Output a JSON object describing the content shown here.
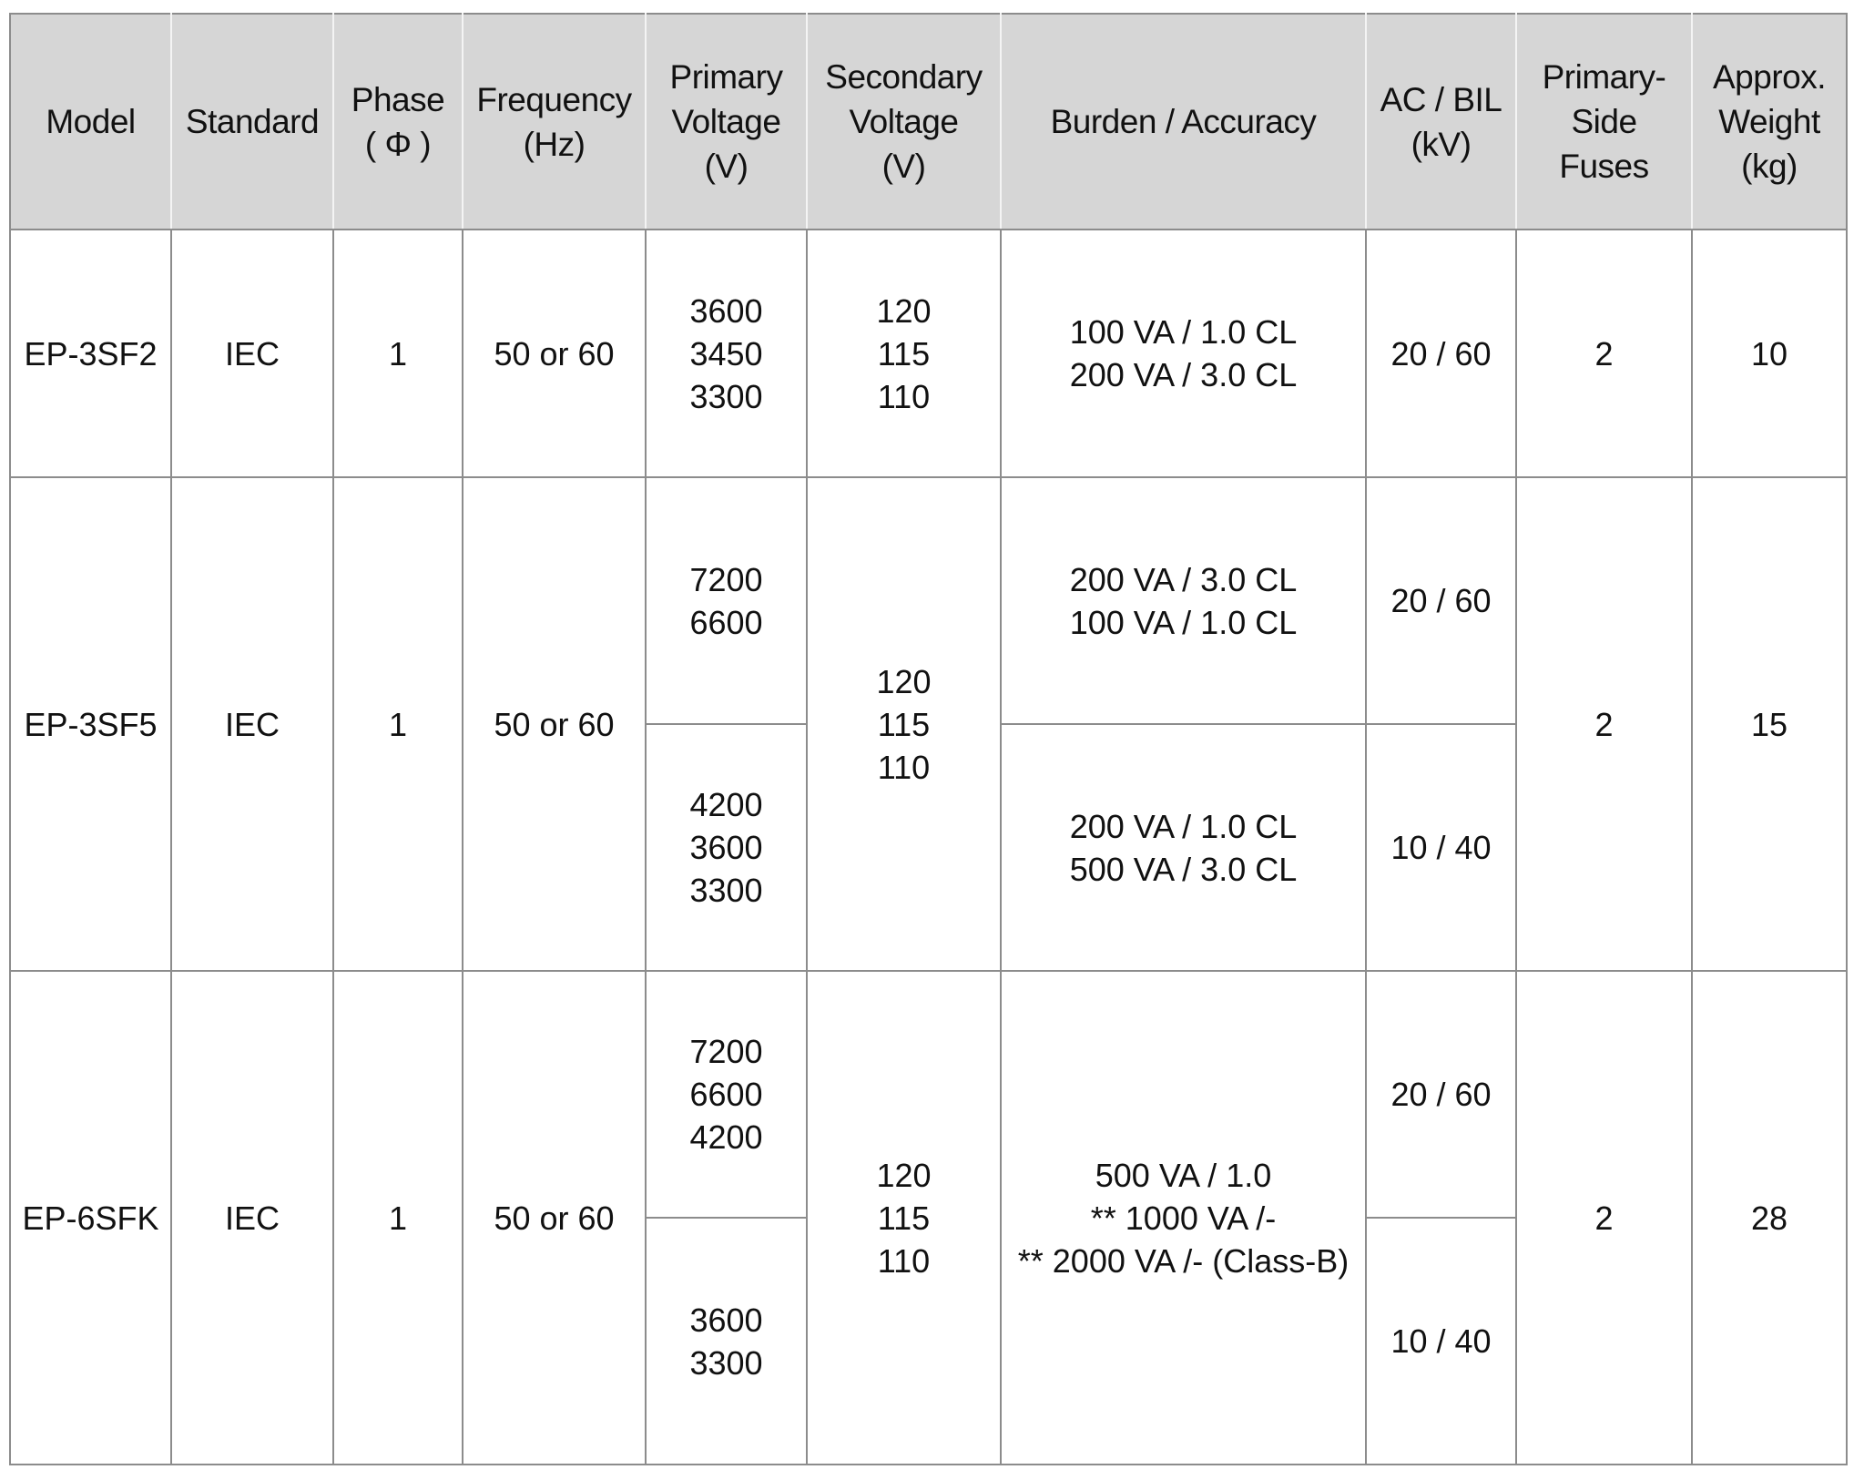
{
  "table": {
    "headers": [
      [
        "Model"
      ],
      [
        "Standard"
      ],
      [
        "Phase",
        "( Φ )"
      ],
      [
        "Frequency",
        "(Hz)"
      ],
      [
        "Primary",
        "Voltage",
        "(V)"
      ],
      [
        "Secondary",
        "Voltage",
        "(V)"
      ],
      [
        "Burden / Accuracy"
      ],
      [
        "AC / BIL",
        "(kV)"
      ],
      [
        "Primary-",
        "Side",
        "Fuses"
      ],
      [
        "Approx.",
        "Weight",
        "(kg)"
      ]
    ],
    "rows": [
      {
        "model": "EP-3SF2",
        "standard": "IEC",
        "phase": "1",
        "frequency": "50 or 60",
        "primary_voltage": [
          [
            "3600",
            "3450",
            "3300"
          ]
        ],
        "secondary_voltage": [
          "120",
          "115",
          "110"
        ],
        "burden_accuracy": [
          [
            "100 VA / 1.0 CL",
            "200 VA / 3.0 CL"
          ]
        ],
        "ac_bil": [
          "20 / 60"
        ],
        "primary_side_fuses": "2",
        "weight": "10"
      },
      {
        "model": "EP-3SF5",
        "standard": "IEC",
        "phase": "1",
        "frequency": "50 or 60",
        "primary_voltage": [
          [
            "7200",
            "6600"
          ],
          [
            "4200",
            "3600",
            "3300"
          ]
        ],
        "secondary_voltage": [
          "120",
          "115",
          "110"
        ],
        "burden_accuracy": [
          [
            "200 VA / 3.0 CL",
            "100 VA / 1.0 CL"
          ],
          [
            "200 VA / 1.0 CL",
            "500 VA / 3.0 CL"
          ]
        ],
        "ac_bil": [
          "20 / 60",
          "10 / 40"
        ],
        "primary_side_fuses": "2",
        "weight": "15"
      },
      {
        "model": "EP-6SFK",
        "standard": "IEC",
        "phase": "1",
        "frequency": "50 or 60",
        "primary_voltage": [
          [
            "7200",
            "6600",
            "4200"
          ],
          [
            "3600",
            "3300"
          ]
        ],
        "secondary_voltage": [
          "120",
          "115",
          "110"
        ],
        "burden_accuracy": [
          [
            "500 VA / 1.0",
            "** 1000 VA /-",
            "** 2000 VA /- (Class-B)"
          ]
        ],
        "ac_bil": [
          "20 / 60",
          "10 / 40"
        ],
        "primary_side_fuses": "2",
        "weight": "28"
      }
    ]
  }
}
